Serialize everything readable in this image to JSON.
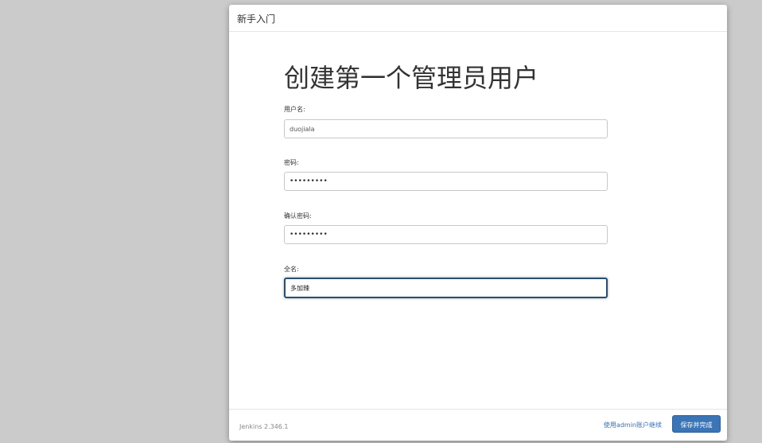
{
  "header": {
    "title": "新手入门"
  },
  "form": {
    "title": "创建第一个管理员用户",
    "username_label": "用户名:",
    "username_value": "duojiala",
    "password_label": "密码:",
    "password_value": "•••••••••",
    "confirm_password_label": "确认密码:",
    "confirm_password_value": "•••••••••",
    "fullname_label": "全名:",
    "fullname_value": "多加辣"
  },
  "footer": {
    "version": "Jenkins 2.346.1",
    "continue_as_admin_label": "使用admin账户继续",
    "save_button_label": "保存并完成"
  },
  "colors": {
    "page_background": "#cbcbcb",
    "primary_button": "#3b75b5",
    "link": "#3a6fb0",
    "focus_border": "#2c4f6d"
  }
}
